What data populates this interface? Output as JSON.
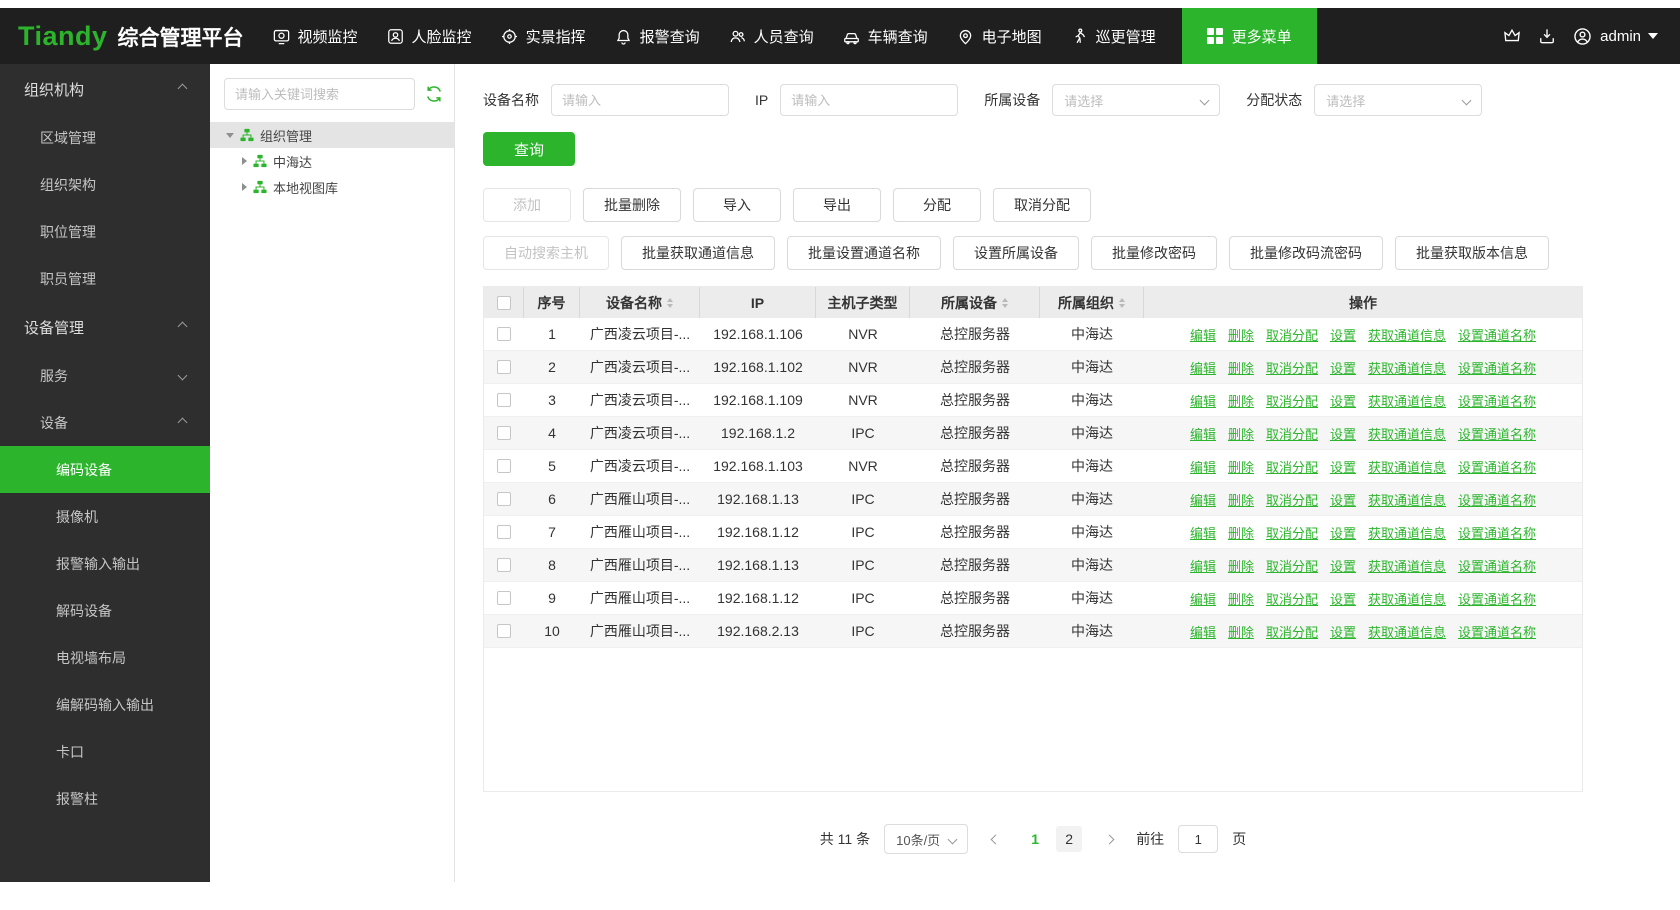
{
  "navbar": {
    "logo": "Tiandy",
    "title": "综合管理平台",
    "items": [
      {
        "label": "视频监控"
      },
      {
        "label": "人脸监控"
      },
      {
        "label": "实景指挥"
      },
      {
        "label": "报警查询"
      },
      {
        "label": "人员查询"
      },
      {
        "label": "车辆查询"
      },
      {
        "label": "电子地图"
      },
      {
        "label": "巡更管理"
      }
    ],
    "more_menu_label": "更多菜单",
    "username": "admin"
  },
  "sidebar": {
    "sections": [
      {
        "label": "组织机构"
      },
      {
        "label": "设备管理"
      }
    ],
    "org_items": [
      "区域管理",
      "组织架构",
      "职位管理",
      "职员管理"
    ],
    "device_groups": [
      "服务",
      "设备"
    ],
    "device_items": [
      "编码设备",
      "摄像机",
      "报警输入输出",
      "解码设备",
      "电视墙布局",
      "编解码输入输出",
      "卡口",
      "报警柱"
    ],
    "active_item": "编码设备"
  },
  "tree": {
    "search_placeholder": "请输入关键词搜索",
    "root_label": "组织管理",
    "children": [
      "中海达",
      "本地视图库"
    ]
  },
  "filters": {
    "device_name_label": "设备名称",
    "device_name_placeholder": "请输入",
    "ip_label": "IP",
    "ip_placeholder": "请输入",
    "parent_device_label": "所属设备",
    "parent_device_placeholder": "请选择",
    "assign_status_label": "分配状态",
    "assign_status_placeholder": "请选择",
    "query_label": "查询"
  },
  "toolbar_row1": [
    {
      "label": "添加",
      "cls": "disabled"
    },
    {
      "label": "批量删除"
    },
    {
      "label": "导入"
    },
    {
      "label": "导出"
    },
    {
      "label": "分配"
    },
    {
      "label": "取消分配"
    }
  ],
  "toolbar_row2": [
    {
      "label": "自动搜索主机",
      "cls": "disabled"
    },
    {
      "label": "批量获取通道信息"
    },
    {
      "label": "批量设置通道名称"
    },
    {
      "label": "设置所属设备"
    },
    {
      "label": "批量修改密码"
    },
    {
      "label": "批量修改码流密码"
    },
    {
      "label": "批量获取版本信息"
    }
  ],
  "table": {
    "headers": {
      "no": "序号",
      "name": "设备名称",
      "ip": "IP",
      "subtype": "主机子类型",
      "device": "所属设备",
      "org": "所属组织",
      "ops": "操作"
    },
    "actions": [
      "编辑",
      "删除",
      "取消分配",
      "设置",
      "获取通道信息",
      "设置通道名称"
    ],
    "rows": [
      {
        "no": "1",
        "name": "广西凌云项目-...",
        "ip": "192.168.1.106",
        "subtype": "NVR",
        "device": "总控服务器",
        "org": "中海达"
      },
      {
        "no": "2",
        "name": "广西凌云项目-...",
        "ip": "192.168.1.102",
        "subtype": "NVR",
        "device": "总控服务器",
        "org": "中海达"
      },
      {
        "no": "3",
        "name": "广西凌云项目-...",
        "ip": "192.168.1.109",
        "subtype": "NVR",
        "device": "总控服务器",
        "org": "中海达"
      },
      {
        "no": "4",
        "name": "广西凌云项目-...",
        "ip": "192.168.1.2",
        "subtype": "IPC",
        "device": "总控服务器",
        "org": "中海达"
      },
      {
        "no": "5",
        "name": "广西凌云项目-...",
        "ip": "192.168.1.103",
        "subtype": "NVR",
        "device": "总控服务器",
        "org": "中海达"
      },
      {
        "no": "6",
        "name": "广西雁山项目-...",
        "ip": "192.168.1.13",
        "subtype": "IPC",
        "device": "总控服务器",
        "org": "中海达"
      },
      {
        "no": "7",
        "name": "广西雁山项目-...",
        "ip": "192.168.1.12",
        "subtype": "IPC",
        "device": "总控服务器",
        "org": "中海达"
      },
      {
        "no": "8",
        "name": "广西雁山项目-...",
        "ip": "192.168.1.13",
        "subtype": "IPC",
        "device": "总控服务器",
        "org": "中海达"
      },
      {
        "no": "9",
        "name": "广西雁山项目-...",
        "ip": "192.168.1.12",
        "subtype": "IPC",
        "device": "总控服务器",
        "org": "中海达"
      },
      {
        "no": "10",
        "name": "广西雁山项目-...",
        "ip": "192.168.2.13",
        "subtype": "IPC",
        "device": "总控服务器",
        "org": "中海达"
      }
    ]
  },
  "pagination": {
    "total_label": "共 11 条",
    "page_size_label": "10条/页",
    "pages": [
      {
        "label": "1",
        "cls": "active"
      },
      {
        "label": "2"
      }
    ],
    "goto_label": "前往",
    "goto_value": "1",
    "page_unit": "页"
  },
  "colors": {
    "accent_green": "#2cb52c",
    "navbar_bg": "#1f1f1f",
    "sidebar_bg": "#2e2e2e",
    "table_header_bg": "#ececec"
  }
}
